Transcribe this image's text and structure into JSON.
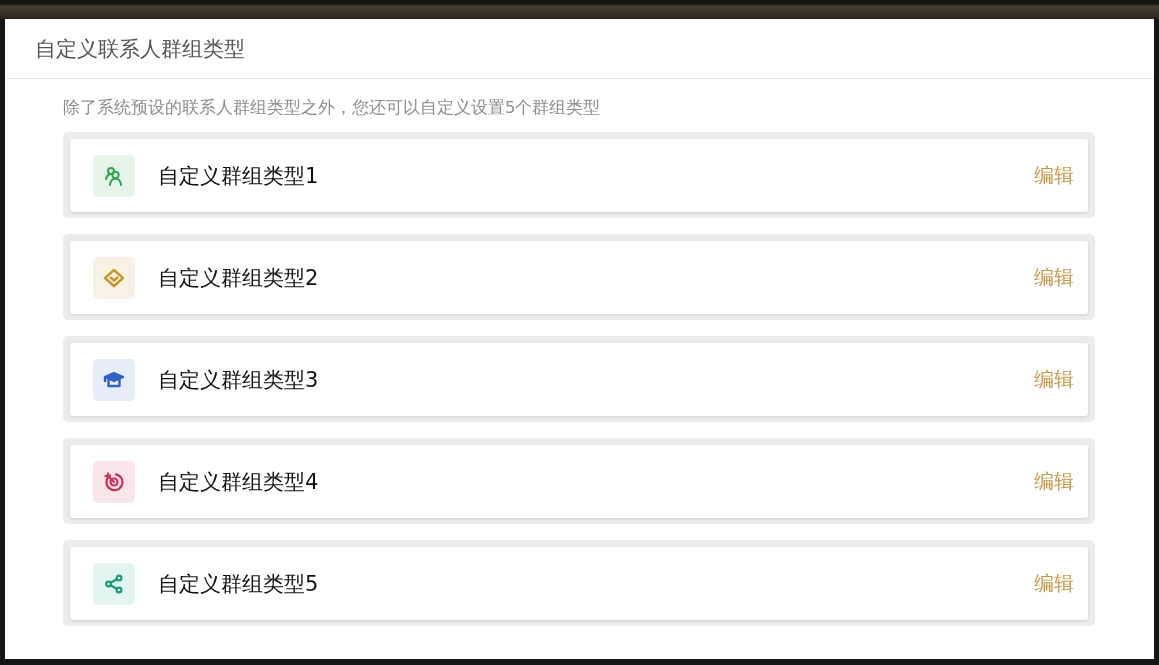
{
  "dialog": {
    "title": "自定义联系人群组类型",
    "description": "除了系统预设的联系人群组类型之外，您还可以自定义设置5个群组类型"
  },
  "groups": [
    {
      "name": "自定义群组类型1",
      "kind": "people",
      "color": "#2ea44f",
      "action": "编辑"
    },
    {
      "name": "自定义群组类型2",
      "kind": "diamond",
      "color": "#c8962e",
      "action": "编辑"
    },
    {
      "name": "自定义群组类型3",
      "kind": "cap",
      "color": "#2f62c9",
      "action": "编辑"
    },
    {
      "name": "自定义群组类型4",
      "kind": "target",
      "color": "#cc2f5e",
      "action": "编辑"
    },
    {
      "name": "自定义群组类型5",
      "kind": "share",
      "color": "#1a9a7e",
      "action": "编辑"
    }
  ]
}
